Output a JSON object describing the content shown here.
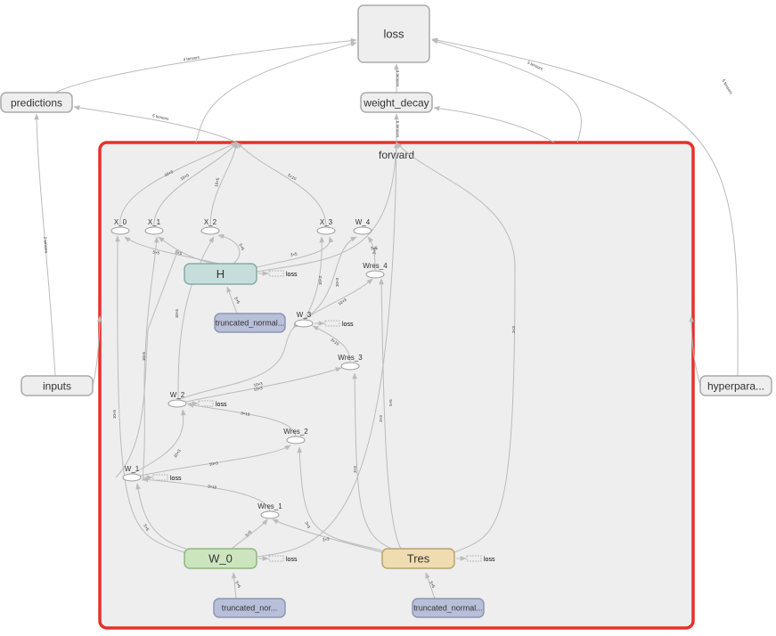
{
  "graph": {
    "top_nodes": {
      "loss": "loss",
      "predictions": "predictions",
      "weight_decay": "weight_decay",
      "inputs": "inputs",
      "hyperparameters": "hyperpara..."
    },
    "forward": {
      "title": "forward",
      "highlight_color": "#e8302a",
      "ops": {
        "H": "H",
        "W_0": "W_0",
        "Tres": "Tres",
        "trunc_h": "truncated_normal...",
        "trunc_w0": "truncated_nor...",
        "trunc_tres": "truncated_normal..."
      },
      "variables": {
        "X_0": "X_0",
        "X_1": "X_1",
        "X_2": "X_2",
        "X_3": "X_3",
        "W_4": "W_4",
        "Wres_4": "Wres_4",
        "W_3": "W_3",
        "Wres_3": "Wres_3",
        "W_2": "W_2",
        "Wres_2": "Wres_2",
        "W_1": "W_1",
        "Wres_1": "Wres_1"
      },
      "summary_label": "loss"
    },
    "edge_labels": {
      "pred_loss": "4 tensors",
      "fwd_pred": "5 tensors",
      "wd_loss": "4 tensors",
      "fwd_wd": "5 tensors",
      "fwd_loss": "5 tensors",
      "hyper_loss": "5 tensors",
      "inputs_pred": "2 tensors",
      "x0": "10×5",
      "x1": "10×5",
      "x2": "10×5",
      "x3": "5×10",
      "h_x": "5×5",
      "h_x3": "3×5",
      "w4": "3×5",
      "w3a": "10×3",
      "w3b": "10×3",
      "w3c": "10×3",
      "w2": "10×3",
      "w1": "10×3",
      "res": "3×10",
      "w0": "5×5",
      "tres": "3×3",
      "trunc": "5×5"
    },
    "colors": {
      "H": "#c6dedb",
      "W_0": "#cde5bf",
      "Tres": "#efdcb0",
      "truncated": "#b8bfd9",
      "default": "#eeeeee"
    }
  }
}
